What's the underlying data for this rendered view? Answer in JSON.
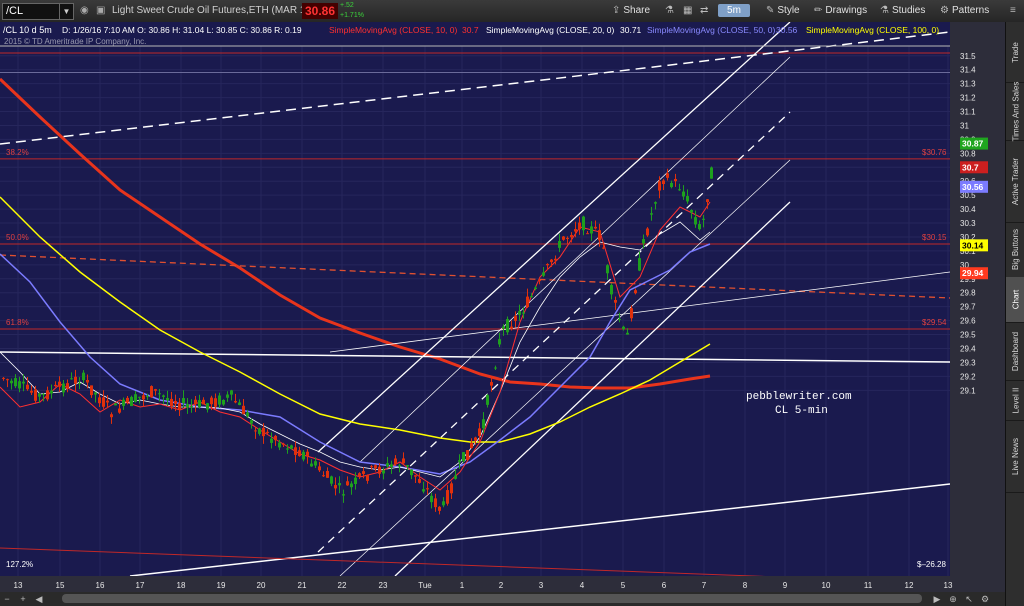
{
  "toolbar": {
    "symbol": "/CL",
    "description": "Light Sweet Crude Oil Futures,ETH (MAR 16)",
    "last_price": "30.86",
    "change": "+.52",
    "change_pct": "+1.71%",
    "share_label": "Share",
    "timeframe": "5m",
    "style_label": "Style",
    "drawings_label": "Drawings",
    "studies_label": "Studies",
    "patterns_label": "Patterns"
  },
  "header": {
    "symbol_info": "/CL 10 d 5m",
    "ohlc": "D: 1/26/16 7:10 AM  O: 30.86  H: 31.04  L: 30.85  C: 30.86  R: 0.19",
    "copyright": "2015 © TD Ameritrade IP Company, Inc.",
    "studies": [
      {
        "label": "SimpleMovingAvg (CLOSE, 10, 0)",
        "value": "30.7",
        "color": "#ff3030"
      },
      {
        "label": "SimpleMovingAvg (CLOSE, 20, 0)",
        "value": "30.71",
        "color": "#ffffff"
      },
      {
        "label": "SimpleMovingAvg (CLOSE, 50, 0)",
        "value": "30.56",
        "color": "#7b7bff"
      },
      {
        "label": "SimpleMovingAvg (CLOSE, 100, 0)",
        "value": "",
        "color": "#ffff00"
      }
    ]
  },
  "right_tabs": [
    "Trade",
    "Times And Sales",
    "Active Trader",
    "Big Buttons",
    "Chart",
    "Dashboard",
    "Level II",
    "Live News"
  ],
  "active_tab": "Chart",
  "annotation": {
    "line1": "pebblewriter.com",
    "line2": "CL 5-min"
  },
  "chart_data": {
    "type": "candlestick",
    "title": "/CL 10 d 5m",
    "x_ticks": [
      "13",
      "15",
      "16",
      "17",
      "18",
      "19",
      "20",
      "21",
      "22",
      "23",
      "Tue",
      "1",
      "2",
      "3",
      "4",
      "5",
      "6",
      "7",
      "8",
      "9",
      "10",
      "11",
      "12",
      "13"
    ],
    "y_ticks": [
      "31.5",
      "31.4",
      "31.3",
      "31.2",
      "31.1",
      "31",
      "30.9",
      "30.8",
      "30.7",
      "30.6",
      "30.5",
      "30.4",
      "30.3",
      "30.2",
      "30.1",
      "30",
      "29.9",
      "29.8",
      "29.7",
      "29.6",
      "29.5",
      "29.4",
      "29.3",
      "29.2",
      "29.1"
    ],
    "ylim": [
      29.05,
      31.58
    ],
    "fib_levels": [
      {
        "label_left": "38.2%",
        "label_right": "$30.76",
        "value": 30.76
      },
      {
        "label_left": "50.0%",
        "label_right": "$30.15",
        "value": 30.15
      },
      {
        "label_left": "61.8%",
        "label_right": "$29.54",
        "value": 29.54
      },
      {
        "label_left": "127.2%",
        "label_right": "$–26.28",
        "value": 29.08
      }
    ],
    "price_badges": [
      {
        "label": "30.87",
        "value": 30.87,
        "color": "#1fa51f"
      },
      {
        "label": "30.7",
        "value": 30.7,
        "color": "#cc1f1f"
      },
      {
        "label": "30.56",
        "value": 30.56,
        "color": "#7b7bff"
      },
      {
        "label": "30.14",
        "value": 30.14,
        "color": "#ffff00"
      },
      {
        "label": "29.94",
        "value": 29.94,
        "color": "#ff3a1f"
      }
    ],
    "series": [
      {
        "name": "SMA(CLOSE,10)",
        "color": "#ff3030"
      },
      {
        "name": "SMA(CLOSE,20)",
        "color": "#ffffff"
      },
      {
        "name": "SMA(CLOSE,50)",
        "color": "#7b7bff"
      },
      {
        "name": "SMA(CLOSE,100)",
        "color": "#ffff00"
      }
    ]
  }
}
